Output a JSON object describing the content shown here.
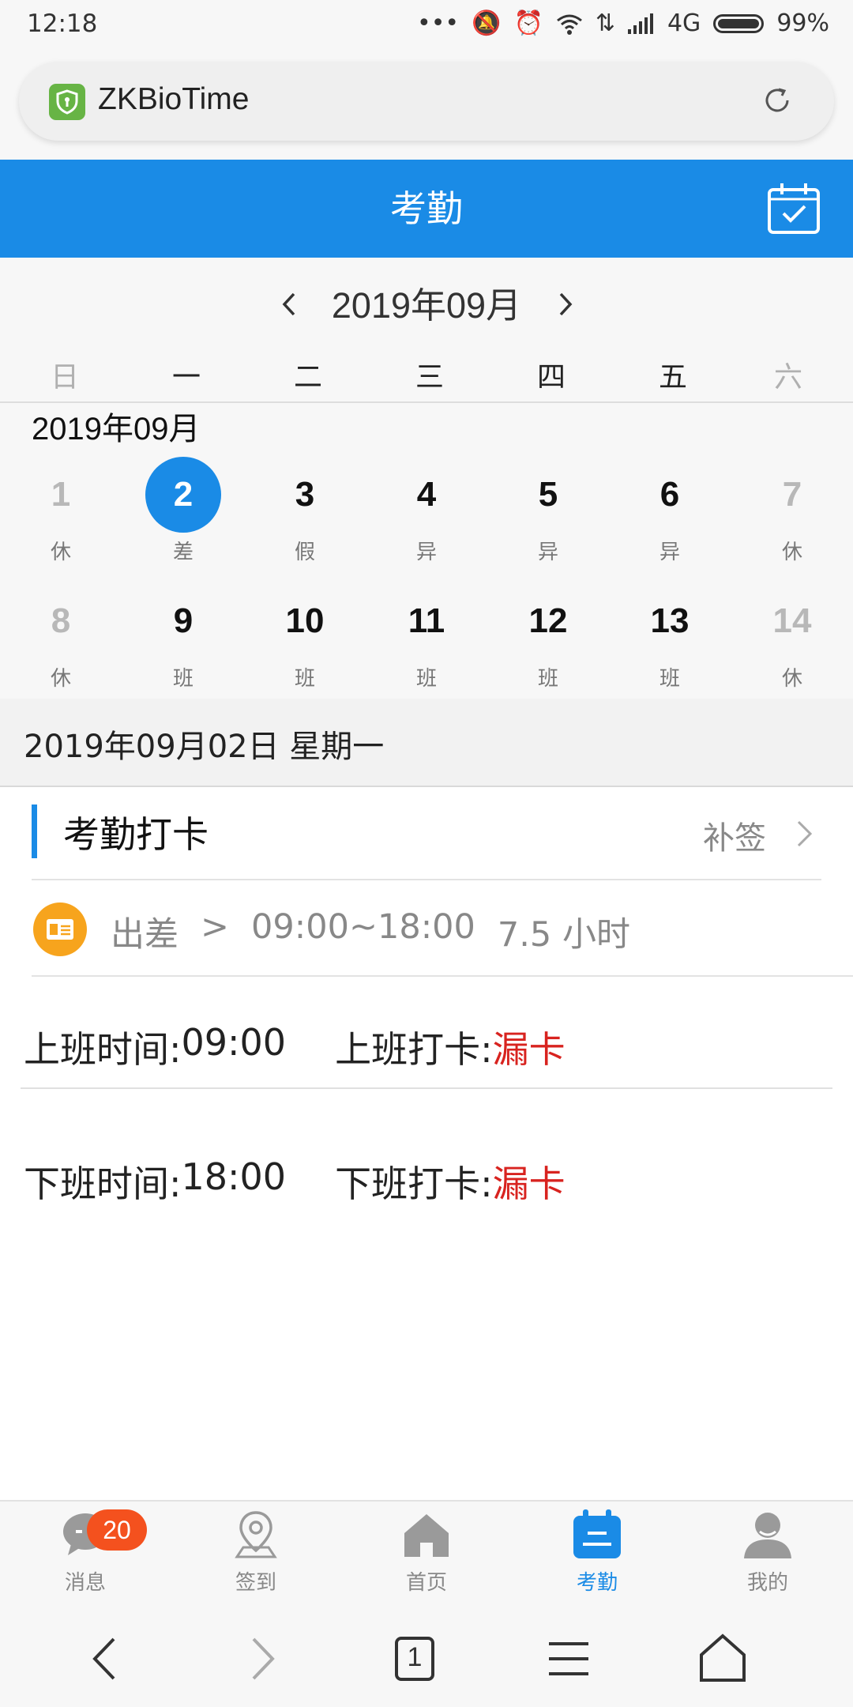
{
  "status": {
    "time": "12:18",
    "network": "4G",
    "battery": "99%"
  },
  "browser": {
    "url_title": "ZKBioTime",
    "tab_count": "1"
  },
  "header": {
    "title": "考勤"
  },
  "calendar": {
    "month_title": "2019年09月",
    "grid_month_label": "2019年09月",
    "weekdays": [
      "日",
      "一",
      "二",
      "三",
      "四",
      "五",
      "六"
    ],
    "weeks": [
      [
        {
          "day": "1",
          "tag": "休"
        },
        {
          "day": "2",
          "tag": "差"
        },
        {
          "day": "3",
          "tag": "假"
        },
        {
          "day": "4",
          "tag": "异"
        },
        {
          "day": "5",
          "tag": "异"
        },
        {
          "day": "6",
          "tag": "异"
        },
        {
          "day": "7",
          "tag": "休"
        }
      ],
      [
        {
          "day": "8",
          "tag": "休"
        },
        {
          "day": "9",
          "tag": "班"
        },
        {
          "day": "10",
          "tag": "班"
        },
        {
          "day": "11",
          "tag": "班"
        },
        {
          "day": "12",
          "tag": "班"
        },
        {
          "day": "13",
          "tag": "班"
        },
        {
          "day": "14",
          "tag": "休"
        }
      ]
    ],
    "selected_day": "2"
  },
  "detail": {
    "date_text": "2019年09月02日 星期一",
    "section_title": "考勤打卡",
    "supplement_label": "补签",
    "trip": {
      "type": "出差",
      "arrow": ">",
      "range": "09:00~18:00",
      "hours": "7.5 小时"
    },
    "punches": [
      {
        "time_label": "上班时间:",
        "time_value": "09:00",
        "punch_label": "上班打卡:",
        "punch_value": "漏卡"
      },
      {
        "time_label": "下班时间:",
        "time_value": "18:00",
        "punch_label": "下班打卡:",
        "punch_value": "漏卡"
      }
    ]
  },
  "tabs": [
    {
      "label": "消息",
      "icon": "message-icon",
      "badge": "20"
    },
    {
      "label": "签到",
      "icon": "location-pin-icon"
    },
    {
      "label": "首页",
      "icon": "home-icon"
    },
    {
      "label": "考勤",
      "icon": "attendance-calendar-icon",
      "active": true
    },
    {
      "label": "我的",
      "icon": "user-icon"
    }
  ],
  "colors": {
    "primary": "#1a8be6",
    "missed": "#d8231f",
    "badge": "#f4511e",
    "trip_icon": "#f7a41d",
    "site_icon": "#67b445"
  }
}
